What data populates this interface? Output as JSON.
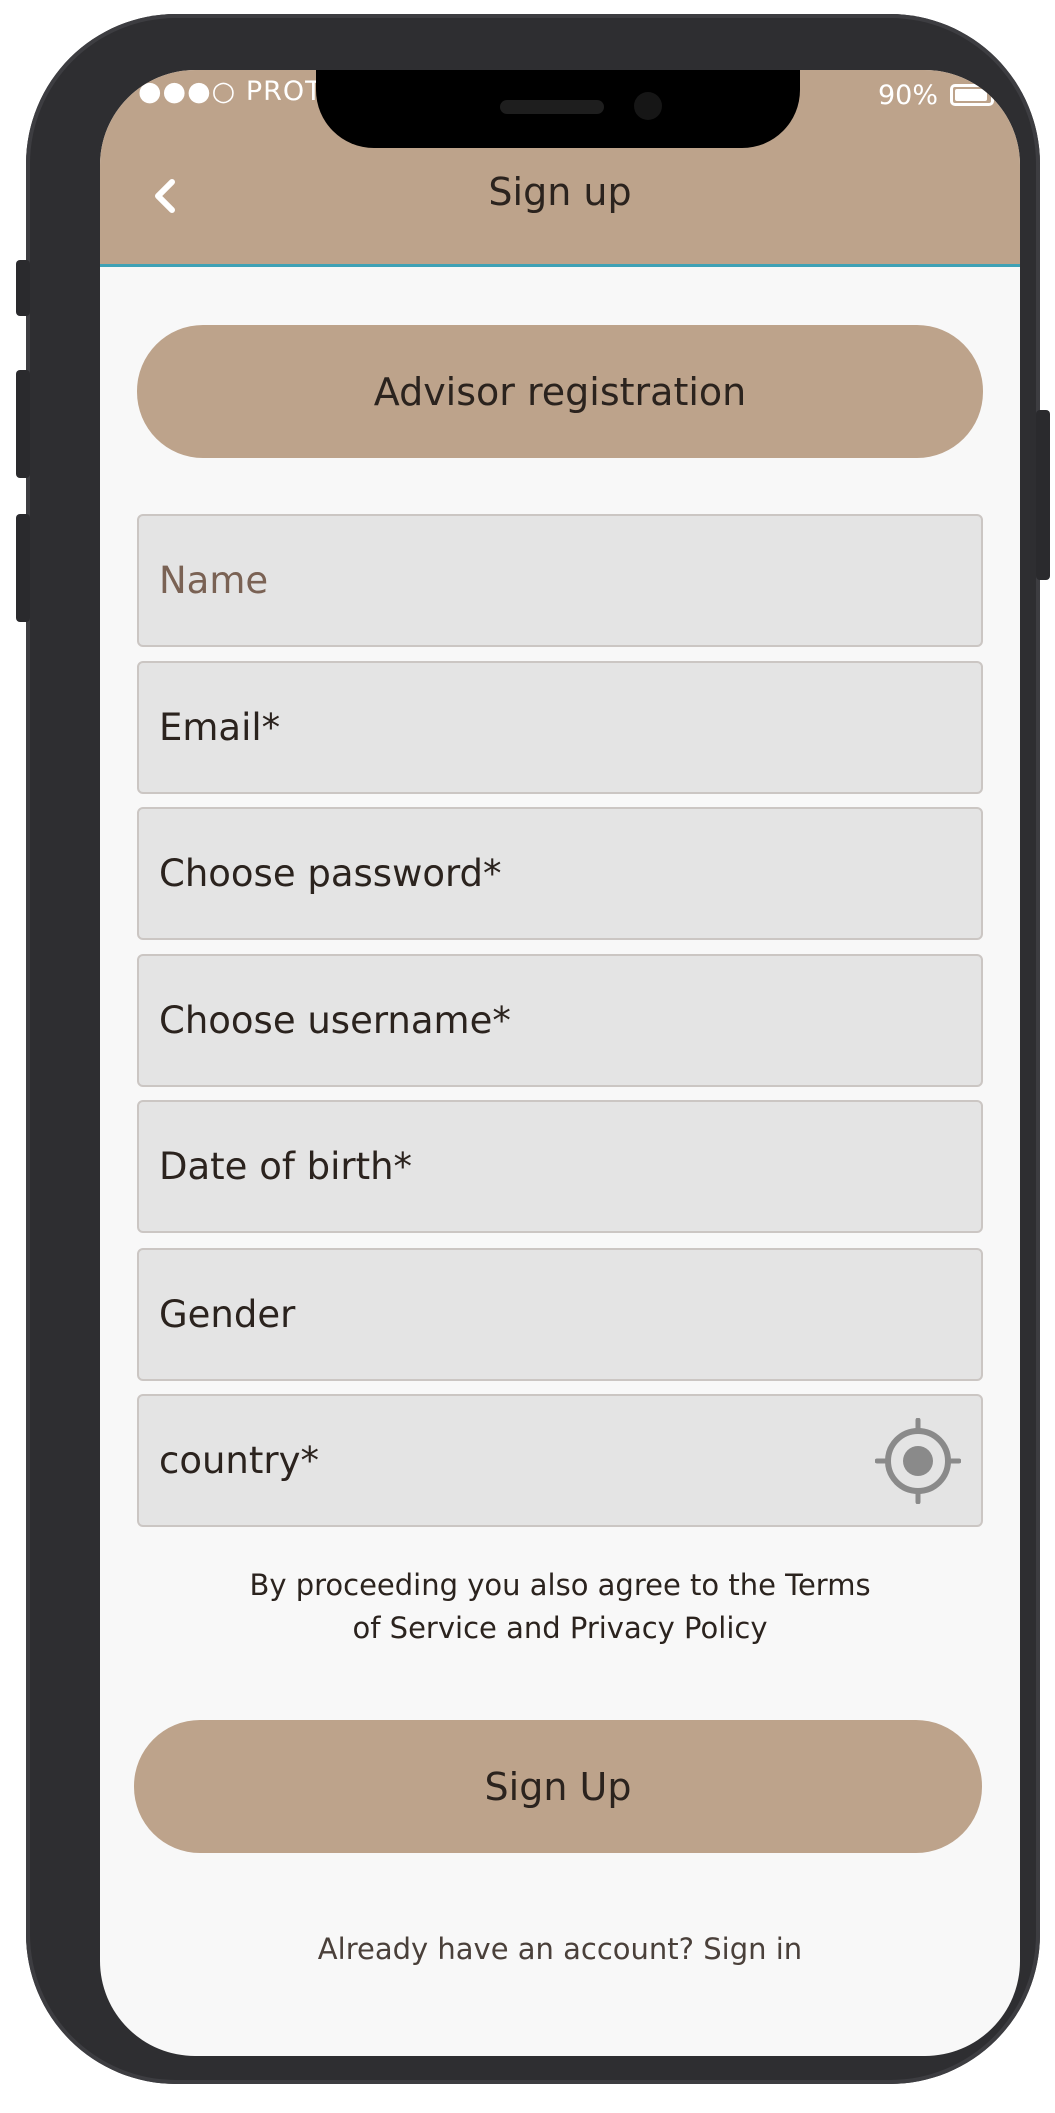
{
  "status_bar": {
    "carrier": "●●●○ PROTO",
    "battery": "90%"
  },
  "header": {
    "title": "Sign up",
    "back_icon": "chevron-left-icon"
  },
  "advisor_button": {
    "label": "Advisor registration"
  },
  "fields": {
    "name": {
      "placeholder": "Name"
    },
    "email": {
      "label": "Email*"
    },
    "password": {
      "label": "Choose password*"
    },
    "username": {
      "label": "Choose username*"
    },
    "dob": {
      "label": "Date of birth*"
    },
    "gender": {
      "label": "Gender"
    },
    "country": {
      "label": "country*",
      "icon": "location-target-icon"
    }
  },
  "terms": {
    "line1": "By proceeding you also agree to the Terms",
    "line2": "of Service and Privacy Policy"
  },
  "signup_button": {
    "label": "Sign Up"
  },
  "signin_link": {
    "label": "Already have an account? Sign in"
  },
  "colors": {
    "brand": "#bda38b",
    "field_bg": "#e4e4e4",
    "accent_line": "#3fa2b6",
    "text": "#2b231e"
  }
}
